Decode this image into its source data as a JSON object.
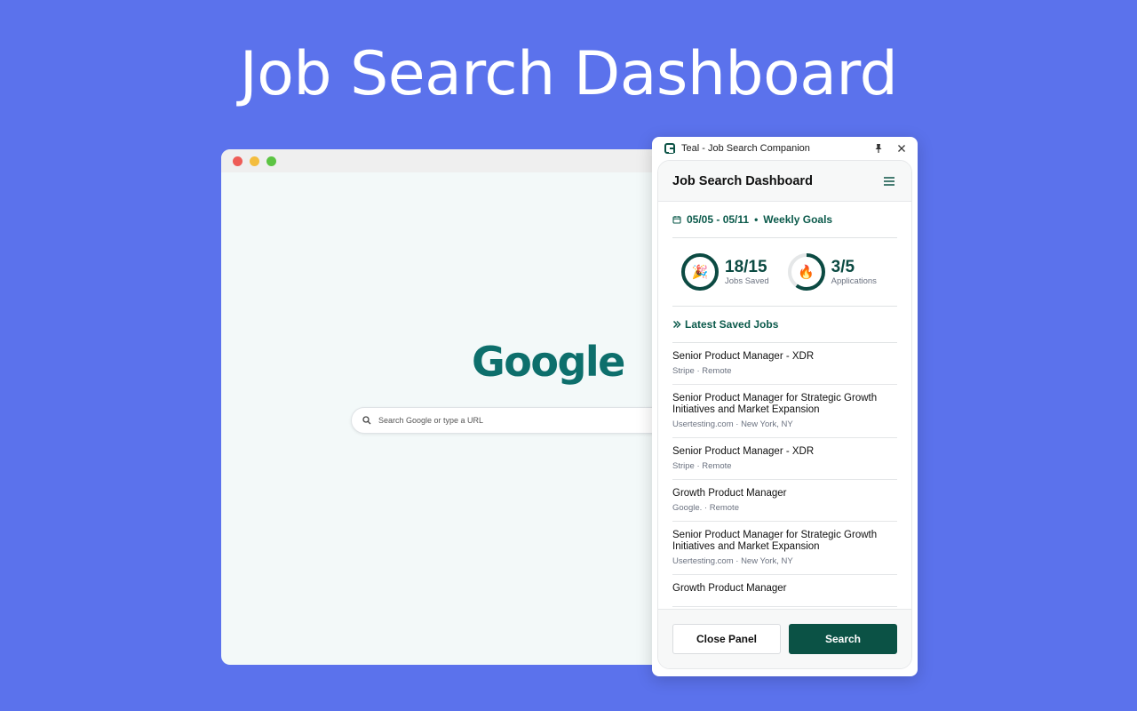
{
  "hero": {
    "title": "Job Search Dashboard"
  },
  "browser": {
    "logo_text": "Google",
    "search_placeholder": "Search Google or type a URL"
  },
  "panel": {
    "app_title": "Teal - Job Search Companion",
    "header_title": "Job Search Dashboard",
    "goals": {
      "date_range": "05/05 - 05/11",
      "separator": "•",
      "label": "Weekly Goals"
    },
    "stats": [
      {
        "value": "18/15",
        "label": "Jobs Saved",
        "progress": 1.0,
        "emoji": "🎉"
      },
      {
        "value": "3/5",
        "label": "Applications",
        "progress": 0.6,
        "emoji": "🔥"
      }
    ],
    "latest_label": "Latest Saved Jobs",
    "jobs": [
      {
        "title": "Senior Product Manager - XDR",
        "meta": "Stripe · Remote"
      },
      {
        "title": "Senior Product Manager for Strategic Growth Initiatives and Market Expansion",
        "meta": "Usertesting.com · New York, NY"
      },
      {
        "title": "Senior Product Manager - XDR",
        "meta": "Stripe · Remote"
      },
      {
        "title": "Growth Product Manager",
        "meta": "Google.  · Remote"
      },
      {
        "title": "Senior Product Manager for Strategic Growth Initiatives and Market Expansion",
        "meta": "Usertesting.com · New York, NY"
      },
      {
        "title": "Growth Product Manager",
        "meta": ""
      }
    ],
    "footer": {
      "close_label": "Close Panel",
      "search_label": "Search"
    }
  },
  "colors": {
    "background": "#5b72ec",
    "teal_primary": "#0b5245",
    "teal_text": "#0b5a4b",
    "google_logo": "#0d6f6c",
    "ring_track": "#e5e7e8"
  }
}
